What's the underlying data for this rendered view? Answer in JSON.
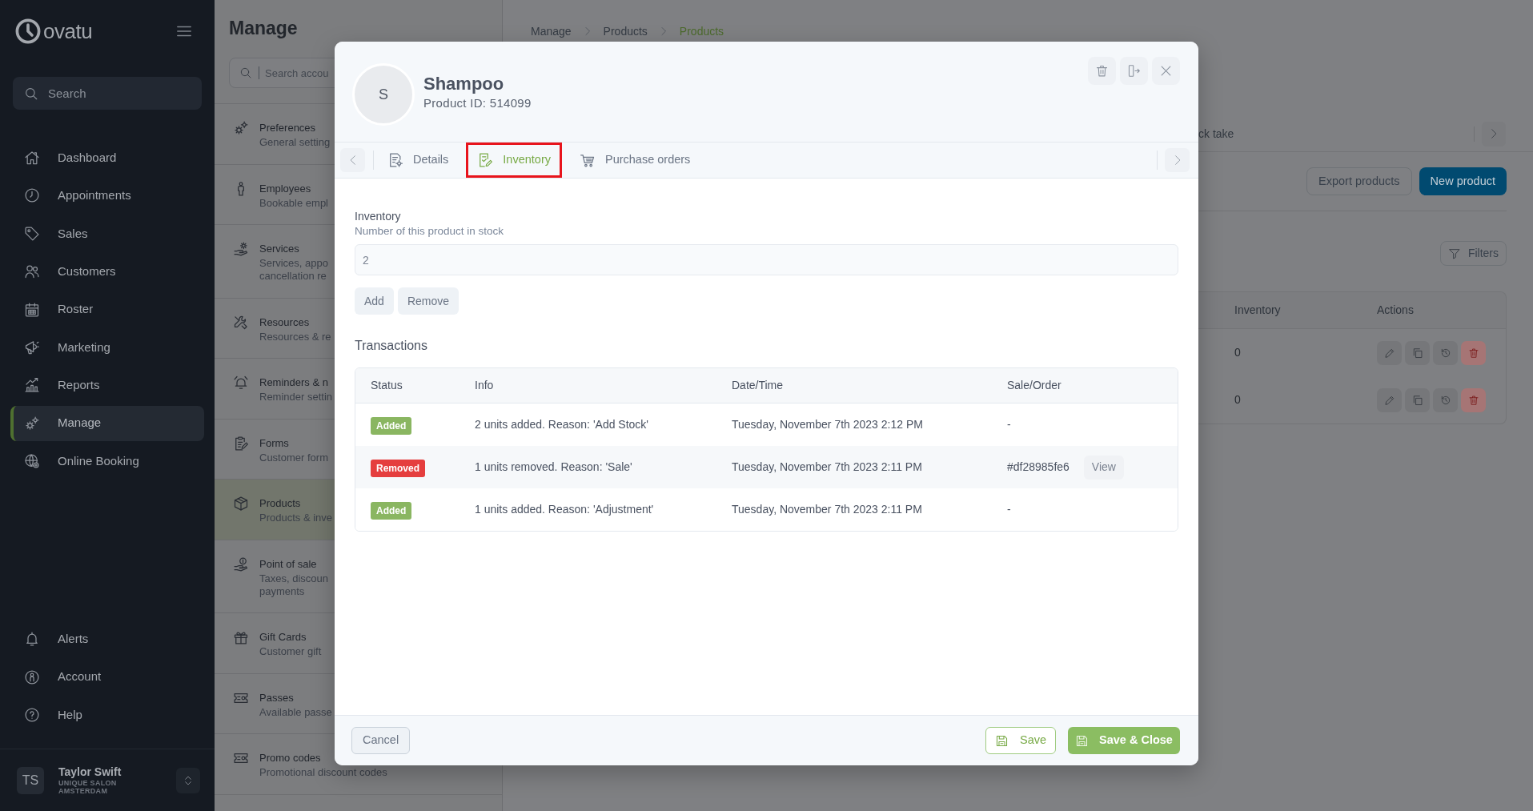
{
  "sidebar": {
    "logo": "ovatu",
    "search": {
      "placeholder": "Search"
    },
    "nav": [
      {
        "label": "Dashboard",
        "selected": false
      },
      {
        "label": "Appointments",
        "selected": false
      },
      {
        "label": "Sales",
        "selected": false
      },
      {
        "label": "Customers",
        "selected": false
      },
      {
        "label": "Roster",
        "selected": false
      },
      {
        "label": "Marketing",
        "selected": false
      },
      {
        "label": "Reports",
        "selected": false
      },
      {
        "label": "Manage",
        "selected": true
      },
      {
        "label": "Online Booking",
        "selected": false
      }
    ],
    "bottom_nav": [
      {
        "label": "Alerts"
      },
      {
        "label": "Account"
      },
      {
        "label": "Help"
      }
    ],
    "user": {
      "initials": "TS",
      "name": "Taylor Swift",
      "organization": "UNIQUE SALON AMSTERDAM"
    }
  },
  "manage_panel": {
    "title": "Manage",
    "search": {
      "placeholder": "Search accou"
    },
    "items": [
      {
        "title": "Preferences",
        "subtitle": [
          "General setting"
        ],
        "selected": false
      },
      {
        "title": "Employees",
        "subtitle": [
          "Bookable empl"
        ],
        "selected": false
      },
      {
        "title": "Services",
        "subtitle": [
          "Services, appo",
          "cancellation re"
        ],
        "selected": false
      },
      {
        "title": "Resources",
        "subtitle": [
          "Resources & re"
        ],
        "selected": false
      },
      {
        "title": "Reminders & n",
        "subtitle": [
          "Reminder settin"
        ],
        "selected": false
      },
      {
        "title": "Forms",
        "subtitle": [
          "Customer form"
        ],
        "selected": false
      },
      {
        "title": "Products",
        "subtitle": [
          "Products & inve"
        ],
        "selected": true
      },
      {
        "title": "Point of sale",
        "subtitle": [
          "Taxes, discoun",
          "payments"
        ],
        "selected": false
      },
      {
        "title": "Gift Cards",
        "subtitle": [
          "Customer gift"
        ],
        "selected": false
      },
      {
        "title": "Passes",
        "subtitle": [
          "Available passe"
        ],
        "selected": false
      },
      {
        "title": "Promo codes",
        "subtitle": [
          "Promotional discount codes"
        ],
        "selected": false
      }
    ]
  },
  "breadcrumb": [
    {
      "label": "Manage",
      "selected": false
    },
    {
      "label": "Products",
      "selected": false
    },
    {
      "label": "Products",
      "selected": true
    }
  ],
  "page_behind": {
    "tab_label": "ck take",
    "buttons": [
      {
        "label": "Export products",
        "kind": "secondary"
      },
      {
        "label": "New product",
        "kind": "primary"
      }
    ],
    "filters": "Filters",
    "table": {
      "columns": [
        "Inventory",
        "Actions"
      ],
      "rows": [
        {
          "inventory": "0"
        },
        {
          "inventory": "0"
        }
      ]
    }
  },
  "dialog": {
    "avatar": "S",
    "title": "Shampoo",
    "subtitle": "Product ID: 514099",
    "tabs": [
      {
        "label": "Details",
        "selected": false,
        "highlighted": false
      },
      {
        "label": "Inventory",
        "selected": true,
        "highlighted": true
      },
      {
        "label": "Purchase orders",
        "selected": false,
        "highlighted": false
      }
    ],
    "inventory": {
      "label": "Inventory",
      "hint": "Number of this product in stock",
      "value": "2",
      "buttons": [
        "Add",
        "Remove"
      ]
    },
    "transactions": {
      "title": "Transactions",
      "columns": [
        "Status",
        "Info",
        "Date/Time",
        "Sale/Order"
      ],
      "rows": [
        {
          "status": "Added",
          "kind": "added",
          "info": "2 units added. Reason: 'Add Stock'",
          "datetime": "Tuesday, November 7th 2023 2:12 PM",
          "order": "-"
        },
        {
          "status": "Removed",
          "kind": "removed",
          "info": "1 units removed. Reason: 'Sale'",
          "datetime": "Tuesday, November 7th 2023 2:11 PM",
          "order": "#df28985fe6",
          "action": "View"
        },
        {
          "status": "Added",
          "kind": "added",
          "info": "1 units added. Reason: 'Adjustment'",
          "datetime": "Tuesday, November 7th 2023 2:11 PM",
          "order": "-"
        }
      ]
    },
    "footer": {
      "cancel": "Cancel",
      "save": "Save",
      "save_close": "Save & Close"
    }
  }
}
